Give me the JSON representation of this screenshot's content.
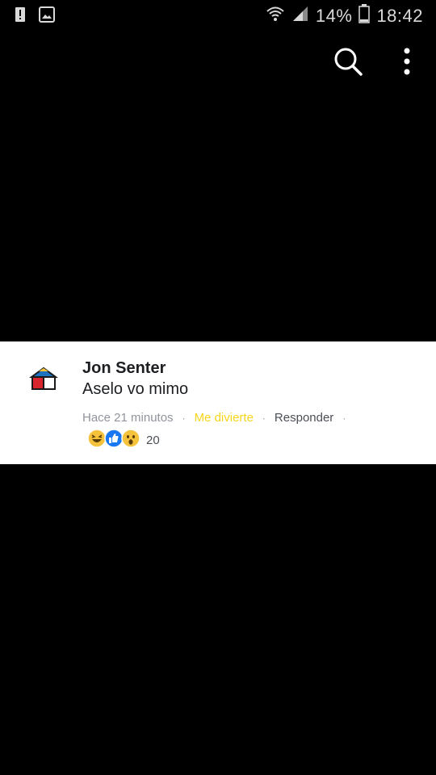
{
  "status_bar": {
    "battery_percent": "14%",
    "time": "18:42",
    "icons": [
      "alert-icon",
      "image-icon",
      "wifi-icon",
      "signal-icon",
      "battery-icon"
    ]
  },
  "toolbar": {
    "icons": [
      "search-icon",
      "more-vert-icon"
    ]
  },
  "comment": {
    "author": "Jon Senter",
    "text": "Aselo vo mimo",
    "time_ago": "Hace 21 minutos",
    "reaction_label": "Me divierte",
    "reply_label": "Responder",
    "separator": "·",
    "reaction_icons": [
      "haha-icon",
      "like-icon",
      "wow-icon"
    ],
    "reaction_count": "20"
  },
  "colors": {
    "reaction_label": "#f7d51d",
    "like_blue": "#1877f2",
    "emoji_yellow": "#f5c33b"
  }
}
